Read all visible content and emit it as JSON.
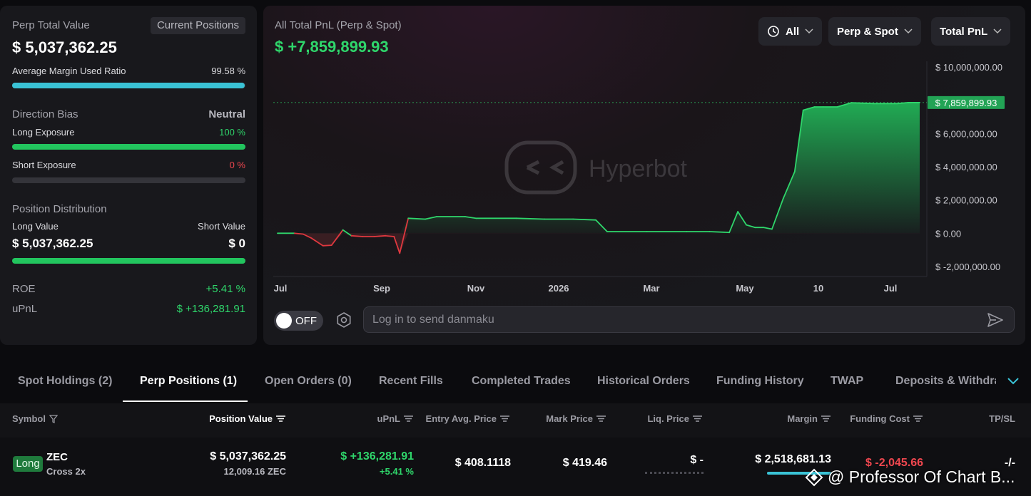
{
  "summary": {
    "title": "Perp Total Value",
    "current_positions_button": "Current Positions",
    "total_value": "$ 5,037,362.25",
    "avg_margin_label": "Average Margin Used Ratio",
    "avg_margin_value": "99.58 %",
    "avg_margin_fraction": 0.9958,
    "direction_label": "Direction Bias",
    "direction_value": "Neutral",
    "long_exposure_label": "Long Exposure",
    "long_exposure_value": "100 %",
    "long_exposure_fraction": 1.0,
    "short_exposure_label": "Short Exposure",
    "short_exposure_value": "0 %",
    "short_exposure_fraction": 0.0,
    "distribution_label": "Position Distribution",
    "long_value_label": "Long Value",
    "short_value_label": "Short Value",
    "long_value": "$ 5,037,362.25",
    "short_value": "$ 0",
    "long_share_fraction": 1.0,
    "roe_label": "ROE",
    "roe_value": "+5.41 %",
    "upnl_label": "uPnL",
    "upnl_value": "$ +136,281.91"
  },
  "pnl": {
    "title": "All Total PnL (Perp & Spot)",
    "value": "$ +7,859,899.93",
    "filter_range": "All",
    "filter_market": "Perp & Spot",
    "filter_metric": "Total PnL",
    "watermark": "Hyperbot",
    "current_label": "$ 7,859,899.93",
    "danmaku_toggle": "OFF",
    "danmaku_placeholder": "Log in to send danmaku"
  },
  "colors": {
    "accent_green": "#2fd66b",
    "accent_red": "#f0474f",
    "accent_cyan": "#3ac3d6"
  },
  "chart_data": {
    "type": "area",
    "x_tick_labels": [
      "Jul",
      "Sep",
      "Nov",
      "2026",
      "Mar",
      "May",
      "10",
      "Jul"
    ],
    "x_tick_positions": [
      0.0,
      0.18,
      0.38,
      0.55,
      0.74,
      0.89,
      0.95,
      1.0
    ],
    "y_ticks": [
      10000000,
      8000000,
      6000000,
      4000000,
      2000000,
      0,
      -2000000
    ],
    "y_tick_labels": [
      "$ 10,000,000.00",
      "$ 6,000,000.00",
      "$ 4,000,000.00",
      "$ 2,000,000.00",
      "$ 0.00",
      "$ -2,000,000.00"
    ],
    "y_tick_label_values": [
      10000000,
      6000000,
      4000000,
      2000000,
      0,
      -2000000
    ],
    "ylim": [
      -2000000,
      10000000
    ],
    "current_value": 7859899.93,
    "series": [
      {
        "points": [
          [
            0.0,
            0
          ],
          [
            0.03,
            0
          ],
          [
            0.045,
            -50000
          ],
          [
            0.06,
            -300000
          ],
          [
            0.08,
            -750000
          ],
          [
            0.095,
            -720000
          ],
          [
            0.115,
            200000
          ],
          [
            0.13,
            -150000
          ],
          [
            0.15,
            -200000
          ],
          [
            0.17,
            -200000
          ],
          [
            0.19,
            -150000
          ],
          [
            0.205,
            -200000
          ],
          [
            0.215,
            -1200000
          ],
          [
            0.23,
            900000
          ],
          [
            0.26,
            850000
          ],
          [
            0.28,
            1000000
          ],
          [
            0.33,
            1000000
          ],
          [
            0.35,
            900000
          ],
          [
            0.42,
            900000
          ],
          [
            0.47,
            850000
          ],
          [
            0.52,
            850000
          ],
          [
            0.56,
            800000
          ],
          [
            0.58,
            100000
          ],
          [
            0.65,
            100000
          ],
          [
            0.72,
            100000
          ],
          [
            0.76,
            100000
          ],
          [
            0.795,
            50000
          ],
          [
            0.81,
            1300000
          ],
          [
            0.825,
            500000
          ],
          [
            0.84,
            350000
          ],
          [
            0.855,
            350000
          ],
          [
            0.87,
            250000
          ],
          [
            0.89,
            2100000
          ],
          [
            0.91,
            3700000
          ],
          [
            0.925,
            7400000
          ],
          [
            0.945,
            7600000
          ],
          [
            0.96,
            7600000
          ],
          [
            0.985,
            7600000
          ],
          [
            1.01,
            7850000
          ],
          [
            1.05,
            7800000
          ],
          [
            1.09,
            7800000
          ],
          [
            1.11,
            7860000
          ],
          [
            1.13,
            7859899.93
          ]
        ]
      }
    ]
  },
  "tabs": [
    {
      "label": "Spot Holdings (2)",
      "active": false
    },
    {
      "label": "Perp Positions (1)",
      "active": true
    },
    {
      "label": "Open Orders (0)",
      "active": false
    },
    {
      "label": "Recent Fills",
      "active": false
    },
    {
      "label": "Completed Trades",
      "active": false
    },
    {
      "label": "Historical Orders",
      "active": false
    },
    {
      "label": "Funding History",
      "active": false
    },
    {
      "label": "TWAP",
      "active": false
    },
    {
      "label": "Deposits & Withdraw",
      "active": false
    }
  ],
  "table": {
    "headers": [
      "Symbol",
      "Position Value",
      "uPnL",
      "Entry Avg. Price",
      "Mark Price",
      "Liq. Price",
      "Margin",
      "Funding Cost",
      "TP/SL"
    ],
    "row": {
      "side": "Long",
      "symbol": "ZEC",
      "mode": "Cross 2x",
      "position_value": "$ 5,037,362.25",
      "position_size": "12,009.16 ZEC",
      "upnl": "$ +136,281.91",
      "upnl_pct": "+5.41 %",
      "entry_price": "$ 408.1118",
      "mark_price": "$ 419.46",
      "liq_price": "$ -",
      "margin": "$ 2,518,681.13",
      "funding_cost": "$ -2,045.66",
      "tpsl": "-/-"
    }
  },
  "watermark_overlay": "@ Professor Of Chart B..."
}
